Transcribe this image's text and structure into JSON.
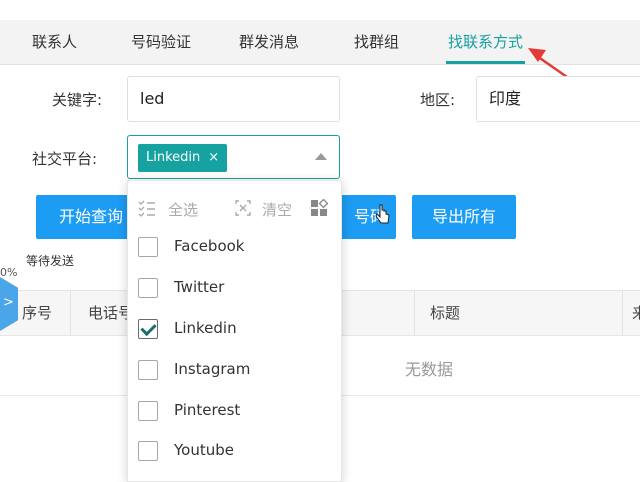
{
  "tabs": [
    {
      "label": "联系人"
    },
    {
      "label": "号码验证"
    },
    {
      "label": "群发消息"
    },
    {
      "label": "找群组"
    },
    {
      "label": "找联系方式",
      "active": true
    }
  ],
  "form": {
    "keyword_label": "关键字:",
    "keyword_value": "led",
    "region_label": "地区:",
    "region_value": "印度",
    "platform_label": "社交平台:",
    "platform_selected": "Linkedin",
    "chip_close": "×"
  },
  "buttons": {
    "start_query": "开始查询",
    "hidden_btn_fragment": "号码",
    "export_all": "导出所有"
  },
  "status": {
    "waiting": "等待发送",
    "progress": "0%"
  },
  "table": {
    "headers": [
      "序号",
      "电话号",
      "标题",
      "来"
    ],
    "empty_text": "无数据"
  },
  "dropdown": {
    "select_all": "全选",
    "clear": "清空",
    "options": [
      {
        "label": "Facebook",
        "checked": false
      },
      {
        "label": "Twitter",
        "checked": false
      },
      {
        "label": "Linkedin",
        "checked": true
      },
      {
        "label": "Instagram",
        "checked": false
      },
      {
        "label": "Pinterest",
        "checked": false
      },
      {
        "label": "Youtube",
        "checked": false
      }
    ]
  },
  "side_toggle": ">",
  "colors": {
    "accent": "#16a0a0",
    "button": "#1c9cf2",
    "annotation_arrow": "#e53935"
  }
}
